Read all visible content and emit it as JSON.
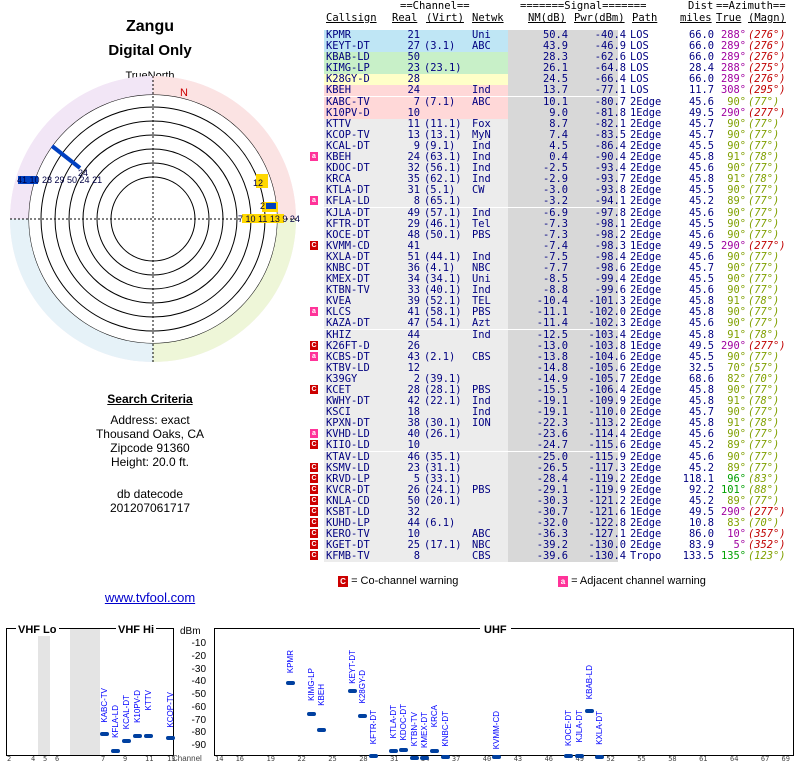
{
  "left": {
    "title": "Zangu",
    "subtitle": "Digital Only",
    "north_label": "TrueNorth",
    "compass_n": "N",
    "criteria_title": "Search Criteria",
    "address": "Address: exact",
    "city": "Thousand Oaks, CA",
    "zip": "Zipcode 91360",
    "height": "Height: 20.0 ft.",
    "datecode_label": "db datecode",
    "datecode": "201207061717",
    "link": "www.tvfool.com"
  },
  "header": {
    "channel_group": "==Channel==",
    "signal_group": "=======Signal=======",
    "dist_group": "Dist",
    "azimuth_group": "==Azimuth==",
    "cols": [
      "Callsign",
      "Real",
      "(Virt)",
      "Netwk",
      "NM(dB)",
      "Pwr(dBm)",
      "Path",
      "miles",
      "True",
      "(Magn)"
    ]
  },
  "rows": [
    {
      "cs": "KPMR",
      "real": "21",
      "virt": "",
      "net": "Uni",
      "nm": "50.4",
      "pwr": "-40.4",
      "path": "LOS",
      "dist": "66.0",
      "tru": "288°",
      "mag": "(276°)",
      "bg": "#bfe6f5",
      "b": ""
    },
    {
      "cs": "KEYT-DT",
      "real": "27",
      "virt": "(3.1)",
      "net": "ABC",
      "nm": "43.9",
      "pwr": "-46.9",
      "path": "LOS",
      "dist": "66.0",
      "tru": "289°",
      "mag": "(276°)",
      "bg": "#bfe6f5",
      "b": ""
    },
    {
      "cs": "KBAB-LD",
      "real": "50",
      "virt": "",
      "net": "",
      "nm": "28.3",
      "pwr": "-62.6",
      "path": "LOS",
      "dist": "66.0",
      "tru": "289°",
      "mag": "(276°)",
      "bg": "#c8f0c8",
      "b": ""
    },
    {
      "cs": "KIMG-LP",
      "real": "23",
      "virt": "(23.1)",
      "net": "",
      "nm": "26.1",
      "pwr": "-64.8",
      "path": "LOS",
      "dist": "28.4",
      "tru": "288°",
      "mag": "(275°)",
      "bg": "#c8f0c8",
      "b": ""
    },
    {
      "cs": "K28GY-D",
      "real": "28",
      "virt": "",
      "net": "",
      "nm": "24.5",
      "pwr": "-66.4",
      "path": "LOS",
      "dist": "66.0",
      "tru": "289°",
      "mag": "(276°)",
      "bg": "#ffffc8",
      "b": ""
    },
    {
      "cs": "KBEH",
      "real": "24",
      "virt": "",
      "net": "Ind",
      "nm": "13.7",
      "pwr": "-77.1",
      "path": "LOS",
      "dist": "11.7",
      "tru": "308°",
      "mag": "(295°)",
      "bg": "#ffd8d8",
      "b": ""
    },
    {
      "cs": "KABC-TV",
      "real": "7",
      "virt": "(7.1)",
      "net": "ABC",
      "nm": "10.1",
      "pwr": "-80.7",
      "path": "2Edge",
      "dist": "45.6",
      "tru": "90°",
      "mag": "(77°)",
      "bg": "#ffd8d8",
      "b": ""
    },
    {
      "cs": "K10PV-D",
      "real": "10",
      "virt": "",
      "net": "",
      "nm": "9.0",
      "pwr": "-81.8",
      "path": "1Edge",
      "dist": "49.5",
      "tru": "290°",
      "mag": "(277°)",
      "bg": "#ffd8d8",
      "b": ""
    },
    {
      "cs": "KTTV",
      "real": "11",
      "virt": "(11.1)",
      "net": "Fox",
      "nm": "8.7",
      "pwr": "-82.1",
      "path": "2Edge",
      "dist": "45.7",
      "tru": "90°",
      "mag": "(77°)",
      "bg": "#ececec",
      "b": ""
    },
    {
      "cs": "KCOP-TV",
      "real": "13",
      "virt": "(13.1)",
      "net": "MyN",
      "nm": "7.4",
      "pwr": "-83.5",
      "path": "2Edge",
      "dist": "45.7",
      "tru": "90°",
      "mag": "(77°)",
      "bg": "#ececec",
      "b": ""
    },
    {
      "cs": "KCAL-DT",
      "real": "9",
      "virt": "(9.1)",
      "net": "Ind",
      "nm": "4.5",
      "pwr": "-86.4",
      "path": "2Edge",
      "dist": "45.5",
      "tru": "90°",
      "mag": "(77°)",
      "bg": "#ececec",
      "b": ""
    },
    {
      "cs": "KBEH",
      "real": "24",
      "virt": "(63.1)",
      "net": "Ind",
      "nm": "0.4",
      "pwr": "-90.4",
      "path": "2Edge",
      "dist": "45.8",
      "tru": "91°",
      "mag": "(78°)",
      "bg": "#ececec",
      "b": "a"
    },
    {
      "cs": "KDOC-DT",
      "real": "32",
      "virt": "(56.1)",
      "net": "Ind",
      "nm": "-2.5",
      "pwr": "-93.4",
      "path": "2Edge",
      "dist": "45.6",
      "tru": "90°",
      "mag": "(77°)",
      "bg": "#ececec",
      "b": ""
    },
    {
      "cs": "KRCA",
      "real": "35",
      "virt": "(62.1)",
      "net": "Ind",
      "nm": "-2.9",
      "pwr": "-93.7",
      "path": "2Edge",
      "dist": "45.8",
      "tru": "91°",
      "mag": "(78°)",
      "bg": "#ececec",
      "b": ""
    },
    {
      "cs": "KTLA-DT",
      "real": "31",
      "virt": "(5.1)",
      "net": "CW",
      "nm": "-3.0",
      "pwr": "-93.8",
      "path": "2Edge",
      "dist": "45.5",
      "tru": "90°",
      "mag": "(77°)",
      "bg": "#ececec",
      "b": ""
    },
    {
      "cs": "KFLA-LD",
      "real": "8",
      "virt": "(65.1)",
      "net": "",
      "nm": "-3.2",
      "pwr": "-94.1",
      "path": "2Edge",
      "dist": "45.2",
      "tru": "89°",
      "mag": "(77°)",
      "bg": "#ececec",
      "b": "a"
    },
    {
      "cs": "KJLA-DT",
      "real": "49",
      "virt": "(57.1)",
      "net": "Ind",
      "nm": "-6.9",
      "pwr": "-97.8",
      "path": "2Edge",
      "dist": "45.6",
      "tru": "90°",
      "mag": "(77°)",
      "bg": "#ececec",
      "b": ""
    },
    {
      "cs": "KFTR-DT",
      "real": "29",
      "virt": "(46.1)",
      "net": "Tel",
      "nm": "-7.3",
      "pwr": "-98.1",
      "path": "2Edge",
      "dist": "45.5",
      "tru": "90°",
      "mag": "(77°)",
      "bg": "#ececec",
      "b": ""
    },
    {
      "cs": "KOCE-DT",
      "real": "48",
      "virt": "(50.1)",
      "net": "PBS",
      "nm": "-7.3",
      "pwr": "-98.2",
      "path": "2Edge",
      "dist": "45.6",
      "tru": "90°",
      "mag": "(77°)",
      "bg": "#ececec",
      "b": ""
    },
    {
      "cs": "KVMM-CD",
      "real": "41",
      "virt": "",
      "net": "",
      "nm": "-7.4",
      "pwr": "-98.3",
      "path": "1Edge",
      "dist": "49.5",
      "tru": "290°",
      "mag": "(277°)",
      "bg": "#ececec",
      "b": "c"
    },
    {
      "cs": "KXLA-DT",
      "real": "51",
      "virt": "(44.1)",
      "net": "Ind",
      "nm": "-7.5",
      "pwr": "-98.4",
      "path": "2Edge",
      "dist": "45.6",
      "tru": "90°",
      "mag": "(77°)",
      "bg": "#ececec",
      "b": ""
    },
    {
      "cs": "KNBC-DT",
      "real": "36",
      "virt": "(4.1)",
      "net": "NBC",
      "nm": "-7.7",
      "pwr": "-98.6",
      "path": "2Edge",
      "dist": "45.7",
      "tru": "90°",
      "mag": "(77°)",
      "bg": "#ececec",
      "b": ""
    },
    {
      "cs": "KMEX-DT",
      "real": "34",
      "virt": "(34.1)",
      "net": "Uni",
      "nm": "-8.5",
      "pwr": "-99.4",
      "path": "2Edge",
      "dist": "45.5",
      "tru": "90°",
      "mag": "(77°)",
      "bg": "#ececec",
      "b": ""
    },
    {
      "cs": "KTBN-TV",
      "real": "33",
      "virt": "(40.1)",
      "net": "Ind",
      "nm": "-8.8",
      "pwr": "-99.6",
      "path": "2Edge",
      "dist": "45.6",
      "tru": "90°",
      "mag": "(77°)",
      "bg": "#ececec",
      "b": ""
    },
    {
      "cs": "KVEA",
      "real": "39",
      "virt": "(52.1)",
      "net": "TEL",
      "nm": "-10.4",
      "pwr": "-101.3",
      "path": "2Edge",
      "dist": "45.8",
      "tru": "91°",
      "mag": "(78°)",
      "bg": "#ececec",
      "b": ""
    },
    {
      "cs": "KLCS",
      "real": "41",
      "virt": "(58.1)",
      "net": "PBS",
      "nm": "-11.1",
      "pwr": "-102.0",
      "path": "2Edge",
      "dist": "45.8",
      "tru": "90°",
      "mag": "(77°)",
      "bg": "#ececec",
      "b": "a"
    },
    {
      "cs": "KAZA-DT",
      "real": "47",
      "virt": "(54.1)",
      "net": "Azt",
      "nm": "-11.4",
      "pwr": "-102.3",
      "path": "2Edge",
      "dist": "45.6",
      "tru": "90°",
      "mag": "(77°)",
      "bg": "#ececec",
      "b": ""
    },
    {
      "cs": "KHIZ",
      "real": "44",
      "virt": "",
      "net": "Ind",
      "nm": "-12.5",
      "pwr": "-103.4",
      "path": "2Edge",
      "dist": "45.8",
      "tru": "91°",
      "mag": "(78°)",
      "bg": "#ececec",
      "b": ""
    },
    {
      "cs": "K26FT-D",
      "real": "26",
      "virt": "",
      "net": "",
      "nm": "-13.0",
      "pwr": "-103.8",
      "path": "1Edge",
      "dist": "49.5",
      "tru": "290°",
      "mag": "(277°)",
      "bg": "#ececec",
      "b": "c"
    },
    {
      "cs": "KCBS-DT",
      "real": "43",
      "virt": "(2.1)",
      "net": "CBS",
      "nm": "-13.8",
      "pwr": "-104.6",
      "path": "2Edge",
      "dist": "45.5",
      "tru": "90°",
      "mag": "(77°)",
      "bg": "#ececec",
      "b": "a"
    },
    {
      "cs": "KTBV-LD",
      "real": "12",
      "virt": "",
      "net": "",
      "nm": "-14.8",
      "pwr": "-105.6",
      "path": "2Edge",
      "dist": "32.5",
      "tru": "70°",
      "mag": "(57°)",
      "bg": "#ececec",
      "b": ""
    },
    {
      "cs": "K39GY",
      "real": "2",
      "virt": "(39.1)",
      "net": "",
      "nm": "-14.9",
      "pwr": "-105.7",
      "path": "2Edge",
      "dist": "68.6",
      "tru": "82°",
      "mag": "(70°)",
      "bg": "#ececec",
      "b": ""
    },
    {
      "cs": "KCET",
      "real": "28",
      "virt": "(28.1)",
      "net": "PBS",
      "nm": "-15.5",
      "pwr": "-106.4",
      "path": "2Edge",
      "dist": "45.8",
      "tru": "90°",
      "mag": "(77°)",
      "bg": "#ececec",
      "b": "c"
    },
    {
      "cs": "KWHY-DT",
      "real": "42",
      "virt": "(22.1)",
      "net": "Ind",
      "nm": "-19.1",
      "pwr": "-109.9",
      "path": "2Edge",
      "dist": "45.8",
      "tru": "91°",
      "mag": "(78°)",
      "bg": "#ececec",
      "b": ""
    },
    {
      "cs": "KSCI",
      "real": "18",
      "virt": "",
      "net": "Ind",
      "nm": "-19.1",
      "pwr": "-110.0",
      "path": "2Edge",
      "dist": "45.7",
      "tru": "90°",
      "mag": "(77°)",
      "bg": "#ececec",
      "b": ""
    },
    {
      "cs": "KPXN-DT",
      "real": "38",
      "virt": "(30.1)",
      "net": "ION",
      "nm": "-22.3",
      "pwr": "-113.2",
      "path": "2Edge",
      "dist": "45.8",
      "tru": "91°",
      "mag": "(78°)",
      "bg": "#ececec",
      "b": ""
    },
    {
      "cs": "KVHD-LD",
      "real": "40",
      "virt": "(26.1)",
      "net": "",
      "nm": "-23.6",
      "pwr": "-114.4",
      "path": "2Edge",
      "dist": "45.6",
      "tru": "90°",
      "mag": "(77°)",
      "bg": "#ececec",
      "b": "a"
    },
    {
      "cs": "KIIO-LD",
      "real": "10",
      "virt": "",
      "net": "",
      "nm": "-24.7",
      "pwr": "-115.6",
      "path": "2Edge",
      "dist": "45.2",
      "tru": "89°",
      "mag": "(77°)",
      "bg": "#ececec",
      "b": "c"
    },
    {
      "cs": "KTAV-LD",
      "real": "46",
      "virt": "(35.1)",
      "net": "",
      "nm": "-25.0",
      "pwr": "-115.9",
      "path": "2Edge",
      "dist": "45.6",
      "tru": "90°",
      "mag": "(77°)",
      "bg": "#ececec",
      "b": ""
    },
    {
      "cs": "KSMV-LD",
      "real": "23",
      "virt": "(31.1)",
      "net": "",
      "nm": "-26.5",
      "pwr": "-117.3",
      "path": "2Edge",
      "dist": "45.2",
      "tru": "89°",
      "mag": "(77°)",
      "bg": "#ececec",
      "b": "c"
    },
    {
      "cs": "KRVD-LP",
      "real": "5",
      "virt": "(33.1)",
      "net": "",
      "nm": "-28.4",
      "pwr": "-119.2",
      "path": "2Edge",
      "dist": "118.1",
      "tru": "96°",
      "mag": "(83°)",
      "bg": "#ececec",
      "b": "c"
    },
    {
      "cs": "KVCR-DT",
      "real": "26",
      "virt": "(24.1)",
      "net": "PBS",
      "nm": "-29.1",
      "pwr": "-119.9",
      "path": "2Edge",
      "dist": "92.2",
      "tru": "101°",
      "mag": "(88°)",
      "bg": "#ececec",
      "b": "c"
    },
    {
      "cs": "KNLA-CD",
      "real": "50",
      "virt": "(20.1)",
      "net": "",
      "nm": "-30.3",
      "pwr": "-121.2",
      "path": "2Edge",
      "dist": "45.2",
      "tru": "89°",
      "mag": "(77°)",
      "bg": "#ececec",
      "b": "c"
    },
    {
      "cs": "KSBT-LD",
      "real": "32",
      "virt": "",
      "net": "",
      "nm": "-30.7",
      "pwr": "-121.6",
      "path": "1Edge",
      "dist": "49.5",
      "tru": "290°",
      "mag": "(277°)",
      "bg": "#ececec",
      "b": "c"
    },
    {
      "cs": "KUHD-LP",
      "real": "44",
      "virt": "(6.1)",
      "net": "",
      "nm": "-32.0",
      "pwr": "-122.8",
      "path": "2Edge",
      "dist": "10.8",
      "tru": "83°",
      "mag": "(70°)",
      "bg": "#ececec",
      "b": "c"
    },
    {
      "cs": "KERO-TV",
      "real": "10",
      "virt": "",
      "net": "ABC",
      "nm": "-36.3",
      "pwr": "-127.1",
      "path": "2Edge",
      "dist": "86.0",
      "tru": "10°",
      "mag": "(357°)",
      "bg": "#ececec",
      "b": "c"
    },
    {
      "cs": "KGET-DT",
      "real": "25",
      "virt": "(17.1)",
      "net": "NBC",
      "nm": "-39.2",
      "pwr": "-130.0",
      "path": "2Edge",
      "dist": "83.9",
      "tru": "5°",
      "mag": "(352°)",
      "bg": "#ececec",
      "b": "c"
    },
    {
      "cs": "KFMB-TV",
      "real": "8",
      "virt": "",
      "net": "CBS",
      "nm": "-39.6",
      "pwr": "-130.4",
      "path": "Tropo",
      "dist": "133.5",
      "tru": "135°",
      "mag": "(123°)",
      "bg": "#ececec",
      "b": "c"
    }
  ],
  "legend": {
    "co_icon": "C",
    "co_text": "= Co-channel warning",
    "adj_icon": "a",
    "adj_text": "= Adjacent channel warning"
  },
  "spectrum": {
    "vhf_lo": "VHF Lo",
    "vhf_hi": "VHF Hi",
    "uhf": "UHF",
    "dbm": "dBm",
    "channel_label": "Channel",
    "dbm_ticks": [
      "-10",
      "-20",
      "-30",
      "-40",
      "-50",
      "-60",
      "-70",
      "-80",
      "-90"
    ],
    "stations": [
      {
        "name": "KABC-TV",
        "ch": 7,
        "pwr": -80.7
      },
      {
        "name": "KFLA-LD",
        "ch": 8,
        "pwr": -94.1
      },
      {
        "name": "KCAL-DT",
        "ch": 9,
        "pwr": -86.4
      },
      {
        "name": "K10PV-D",
        "ch": 10,
        "pwr": -81.8
      },
      {
        "name": "KTTV",
        "ch": 11,
        "pwr": -82.1
      },
      {
        "name": "KCOP-TV",
        "ch": 13,
        "pwr": -83.5
      },
      {
        "name": "KPMR",
        "ch": 21,
        "pwr": -40.4
      },
      {
        "name": "KIMG-LP",
        "ch": 23,
        "pwr": -64.8
      },
      {
        "name": "KBEH",
        "ch": 24,
        "pwr": -77.1
      },
      {
        "name": "KEYT-DT",
        "ch": 27,
        "pwr": -46.9
      },
      {
        "name": "K28GY-D",
        "ch": 28,
        "pwr": -66.4
      },
      {
        "name": "KFTR-DT",
        "ch": 29,
        "pwr": -98.1
      },
      {
        "name": "KTLA-DT",
        "ch": 31,
        "pwr": -93.8
      },
      {
        "name": "KDOC-DT",
        "ch": 32,
        "pwr": -93.4
      },
      {
        "name": "KTBN-TV",
        "ch": 33,
        "pwr": -99.6
      },
      {
        "name": "KMEX-DT",
        "ch": 34,
        "pwr": -99.4
      },
      {
        "name": "KRCA",
        "ch": 35,
        "pwr": -93.7
      },
      {
        "name": "KNBC-DT",
        "ch": 36,
        "pwr": -98.6
      },
      {
        "name": "KVMM-CD",
        "ch": 41,
        "pwr": -98.3
      },
      {
        "name": "KOCE-DT",
        "ch": 48,
        "pwr": -98.2
      },
      {
        "name": "KJLA-DT",
        "ch": 49,
        "pwr": -97.8
      },
      {
        "name": "KBAB-LD",
        "ch": 50,
        "pwr": -62.6
      },
      {
        "name": "KXLA-DT",
        "ch": 51,
        "pwr": -98.4
      }
    ],
    "channel_ticks": [
      "2",
      "4",
      "5",
      "6",
      "7",
      "9",
      "11",
      "13",
      "14",
      "16",
      "19",
      "22",
      "25",
      "28",
      "31",
      "34",
      "37",
      "40",
      "43",
      "46",
      "49",
      "52",
      "55",
      "58",
      "61",
      "64",
      "67",
      "69"
    ]
  }
}
